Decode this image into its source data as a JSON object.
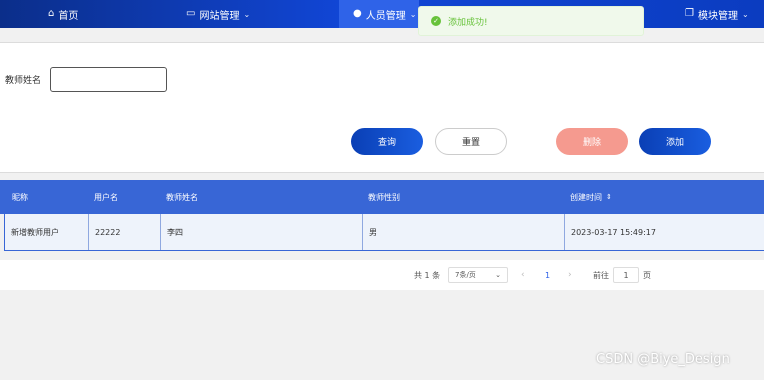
{
  "nav": {
    "home": "首页",
    "website": "网站管理",
    "personnel": "人员管理",
    "modules": "模块管理"
  },
  "toast": {
    "message": "添加成功!"
  },
  "search": {
    "label": "教师姓名",
    "value": "",
    "placeholder": ""
  },
  "buttons": {
    "query": "查询",
    "reset": "重置",
    "delete": "删除",
    "add": "添加"
  },
  "table": {
    "columns": [
      "昵称",
      "用户名",
      "教师姓名",
      "教师性别",
      "创建时间"
    ],
    "rows": [
      [
        "新增教师用户",
        "22222",
        "李四",
        "男",
        "2023-03-17 15:49:17"
      ]
    ]
  },
  "pager": {
    "total": "共 1 条",
    "page_size": "7条/页",
    "current": "1",
    "goto": "前往",
    "goto_value": "1",
    "page_unit": "页"
  },
  "watermark": "CSDN @Biye_Design",
  "colors": {
    "nav": "#0b2e8a",
    "accent": "#3866d6",
    "danger": "#f59a8f",
    "success": "#67c23a"
  }
}
